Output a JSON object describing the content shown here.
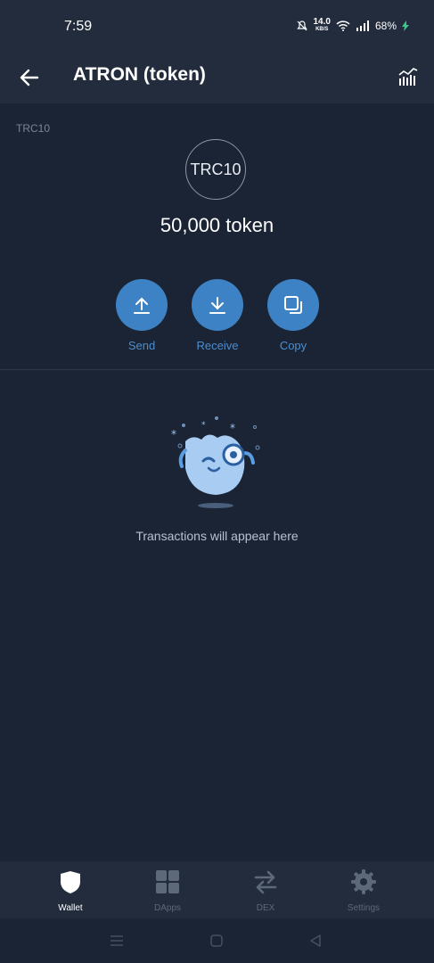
{
  "status": {
    "time": "7:59",
    "net_speed": "14.0",
    "net_unit": "KB/S",
    "battery": "68%"
  },
  "header": {
    "title": "ATRON (token)",
    "back_icon": "arrow-left-icon",
    "chart_icon": "chart-icon"
  },
  "token": {
    "type_tag": "TRC10",
    "logo_text": "TRC10",
    "balance": "50,000 token"
  },
  "actions": [
    {
      "label": "Send",
      "icon": "upload-icon"
    },
    {
      "label": "Receive",
      "icon": "download-icon"
    },
    {
      "label": "Copy",
      "icon": "copy-icon"
    }
  ],
  "empty_state": {
    "message": "Transactions will appear here"
  },
  "tabs": [
    {
      "label": "Wallet",
      "icon": "shield-icon",
      "active": true
    },
    {
      "label": "DApps",
      "icon": "grid-icon",
      "active": false
    },
    {
      "label": "DEX",
      "icon": "swap-icon",
      "active": false
    },
    {
      "label": "Settings",
      "icon": "gear-icon",
      "active": false
    }
  ],
  "colors": {
    "background": "#1b2434",
    "bar": "#222c3c",
    "accent": "#3d82c4",
    "accent_text": "#4b8ed0"
  }
}
